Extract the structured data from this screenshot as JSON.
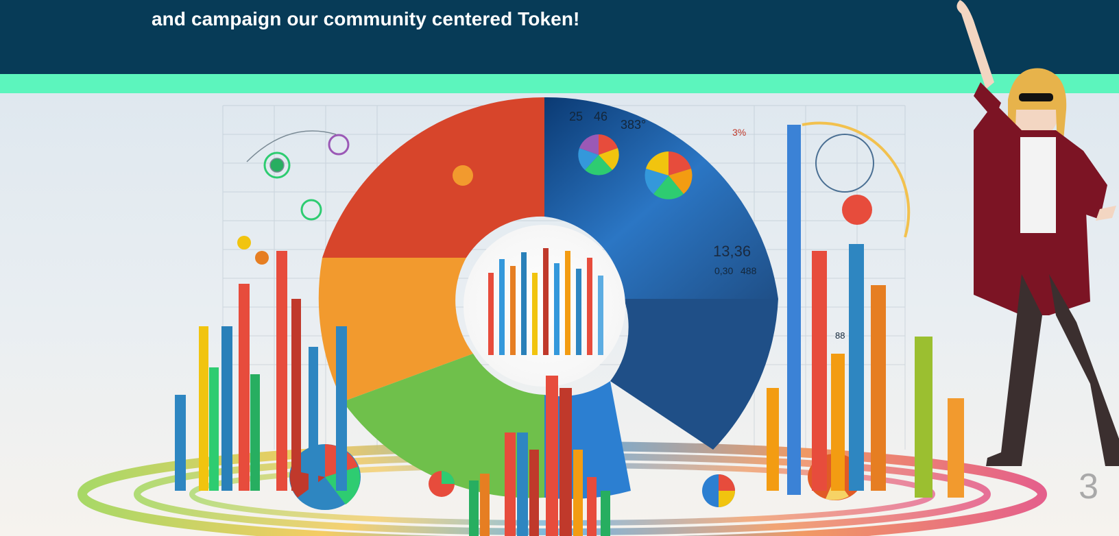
{
  "slide": {
    "header_text": "and campaign our community centered Token!",
    "slide_number": "3"
  },
  "artwork": {
    "numbers_shown": [
      "25",
      "46",
      "383°",
      "3%",
      "13,36",
      "0,30",
      "488",
      "88"
    ],
    "colors": {
      "header_bg": "#073b57",
      "accent_stripe": "#5cf5bd",
      "slide_number": "#a9a9a9"
    }
  }
}
